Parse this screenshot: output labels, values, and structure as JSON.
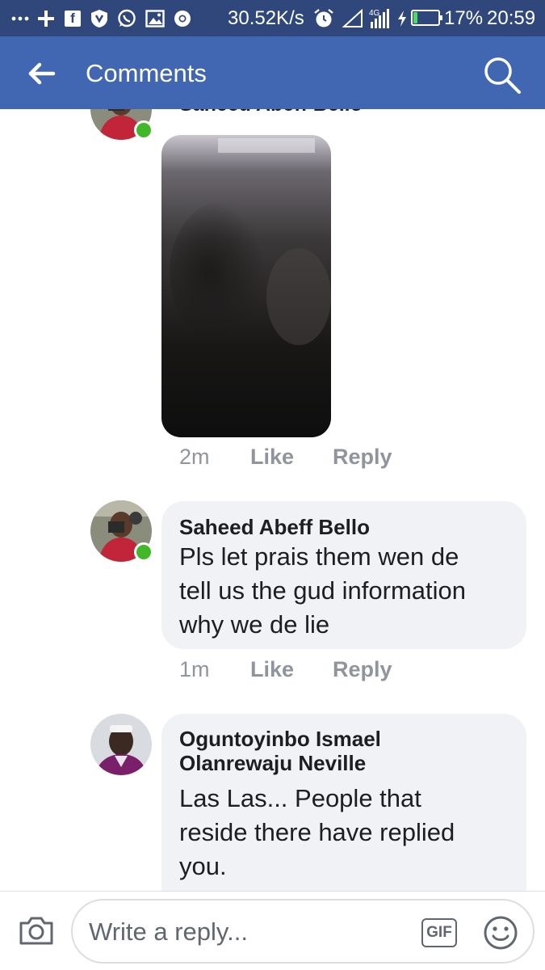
{
  "status_bar": {
    "icons": [
      "more-dots-icon",
      "plus-icon",
      "facebook-icon",
      "shield-icon",
      "whatsapp-icon",
      "image-icon",
      "chrome-icon",
      "alarm-icon",
      "signal-icon",
      "network-icon",
      "battery-icon"
    ],
    "net_speed": "30.52K/s",
    "network_type": "4G",
    "battery_percent": "17%",
    "battery_level": 0.17,
    "time": "20:59"
  },
  "app_bar": {
    "back_icon": "back-arrow-icon",
    "title": "Comments",
    "search_icon": "search-icon"
  },
  "comments": [
    {
      "author": "Saheed Abeff Bello",
      "text": "",
      "has_media": true,
      "online": true,
      "time": "2m",
      "like_label": "Like",
      "reply_label": "Reply"
    },
    {
      "author": "Saheed Abeff Bello",
      "text_lines": [
        "Pls let prais them wen de",
        "tell us the gud information",
        "why we de lie"
      ],
      "online": true,
      "time": "1m",
      "like_label": "Like",
      "reply_label": "Reply"
    },
    {
      "author_lines": [
        "Oguntoyinbo Ismael",
        "Olanrewaju Neville"
      ],
      "text_lines": [
        "Las Las... People that",
        "reside there have replied",
        "you."
      ],
      "online": false
    }
  ],
  "composer": {
    "camera_icon": "camera-icon",
    "placeholder": "Write a reply...",
    "gif_label": "GIF",
    "emoji_icon": "emoji-icon"
  },
  "colors": {
    "status_bar": "#2f477b",
    "app_bar": "#4267b2",
    "bubble": "#f1f2f5",
    "online": "#42b72a",
    "meta_text": "#90949c"
  }
}
